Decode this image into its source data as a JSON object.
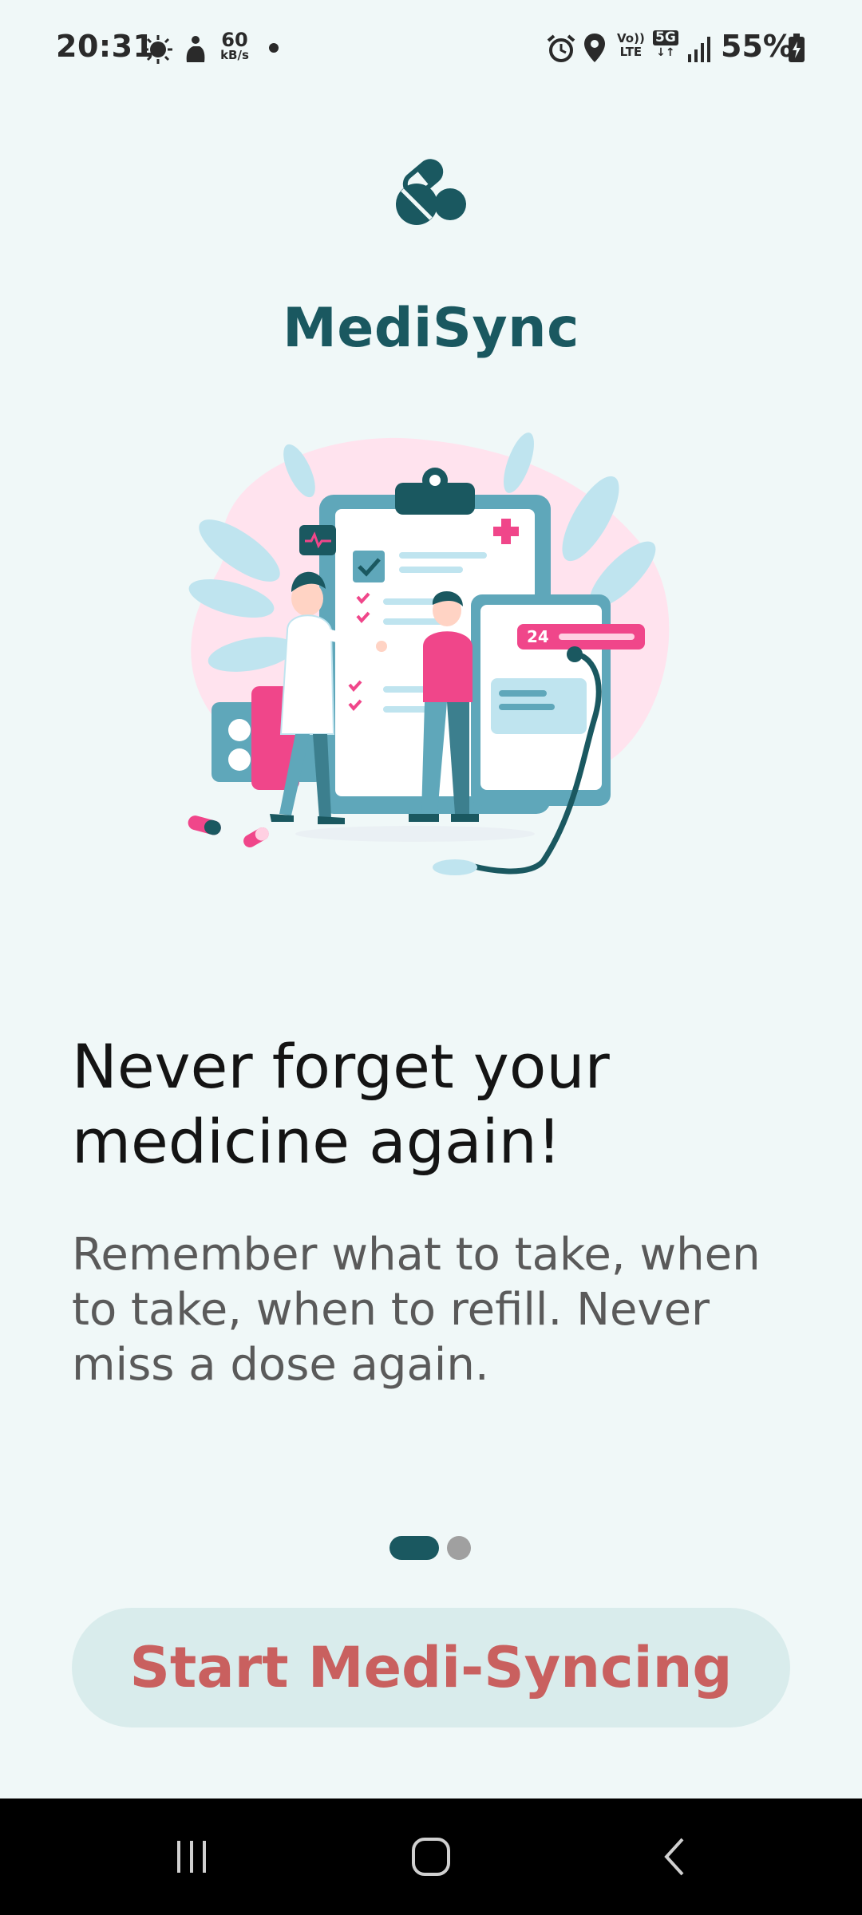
{
  "status_bar": {
    "time": "20:31",
    "net_speed_value": "60",
    "net_speed_unit": "kB/s",
    "volte_top": "Vo))",
    "volte_bottom": "LTE",
    "network_type": "5G",
    "battery_percent": "55%",
    "icons": [
      "weather-icon",
      "notification-icon",
      "alarm-icon",
      "location-icon",
      "signal-icon",
      "battery-icon"
    ]
  },
  "app": {
    "name": "MediSync",
    "logo_icon": "pills-icon"
  },
  "onboarding": {
    "headline_line1": "Never forget your",
    "headline_line2": "medicine again!",
    "subtext_line1": "Remember what to take, when",
    "subtext_line2": "to take, when to refill. Never",
    "subtext_line3": "miss a dose again.",
    "illustration_badge": "24",
    "page_index": 1,
    "page_count": 2
  },
  "cta": {
    "label": "Start Medi-Syncing"
  },
  "navigation": {
    "recents_icon": "recents-icon",
    "home_icon": "home-icon",
    "back_icon": "back-icon"
  },
  "colors": {
    "background": "#f0f8f8",
    "brand_teal": "#1a5860",
    "cta_text": "#c9605f",
    "cta_background": "#d9ecec",
    "accent_pink": "#f0468a"
  }
}
